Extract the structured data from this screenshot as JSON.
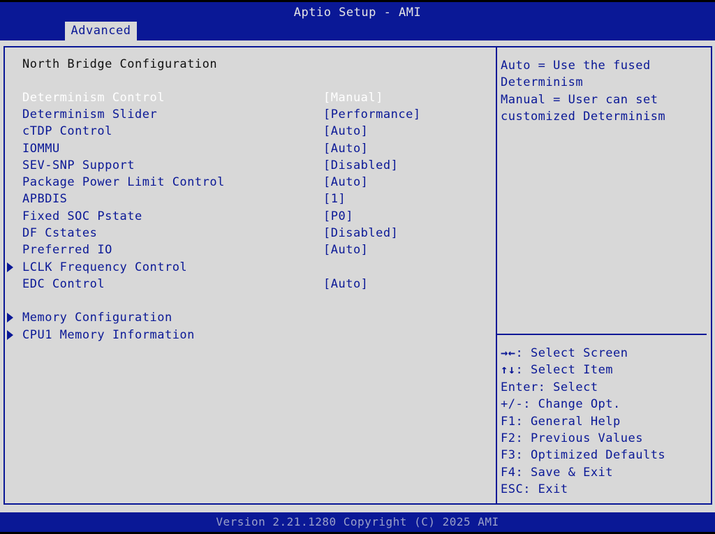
{
  "title": "Aptio Setup - AMI",
  "tab": {
    "label": "Advanced"
  },
  "section_heading": "North Bridge Configuration",
  "settings": [
    {
      "label": "Determinism Control",
      "value": "[Manual]",
      "selected": true
    },
    {
      "label": "Determinism Slider",
      "value": "[Performance]"
    },
    {
      "label": "cTDP Control",
      "value": "[Auto]"
    },
    {
      "label": "IOMMU",
      "value": "[Auto]"
    },
    {
      "label": "SEV-SNP Support",
      "value": "[Disabled]"
    },
    {
      "label": "Package Power Limit Control",
      "value": "[Auto]"
    },
    {
      "label": "APBDIS",
      "value": "[1]"
    },
    {
      "label": "Fixed SOC Pstate",
      "value": "[P0]"
    },
    {
      "label": "DF Cstates",
      "value": "[Disabled]"
    },
    {
      "label": "Preferred IO",
      "value": "[Auto]"
    },
    {
      "label": "LCLK Frequency Control",
      "value": "",
      "submenu": true
    },
    {
      "label": "EDC Control",
      "value": "[Auto]"
    },
    {
      "label": "Memory Configuration",
      "value": "",
      "submenu": true
    },
    {
      "label": "CPU1 Memory Information",
      "value": "",
      "submenu": true
    }
  ],
  "help_lines": [
    "Auto = Use the fused",
    "Determinism",
    "Manual = User can set",
    "customized Determinism"
  ],
  "key_help": [
    {
      "key": "→←",
      "action": ": Select Screen"
    },
    {
      "key": "↑↓",
      "action": ": Select Item"
    },
    {
      "key": "",
      "action": "Enter: Select"
    },
    {
      "key": "",
      "action": "+/-: Change Opt."
    },
    {
      "key": "",
      "action": "F1: General Help"
    },
    {
      "key": "",
      "action": "F2: Previous Values"
    },
    {
      "key": "",
      "action": "F3: Optimized Defaults"
    },
    {
      "key": "",
      "action": "F4: Save & Exit"
    },
    {
      "key": "",
      "action": "ESC: Exit"
    }
  ],
  "version_text": "Version 2.21.1280 Copyright (C) 2025 AMI",
  "colors": {
    "frame_blue": "#0a1896",
    "panel_gray": "#d8d8d8",
    "selected_text": "#ffffff"
  }
}
